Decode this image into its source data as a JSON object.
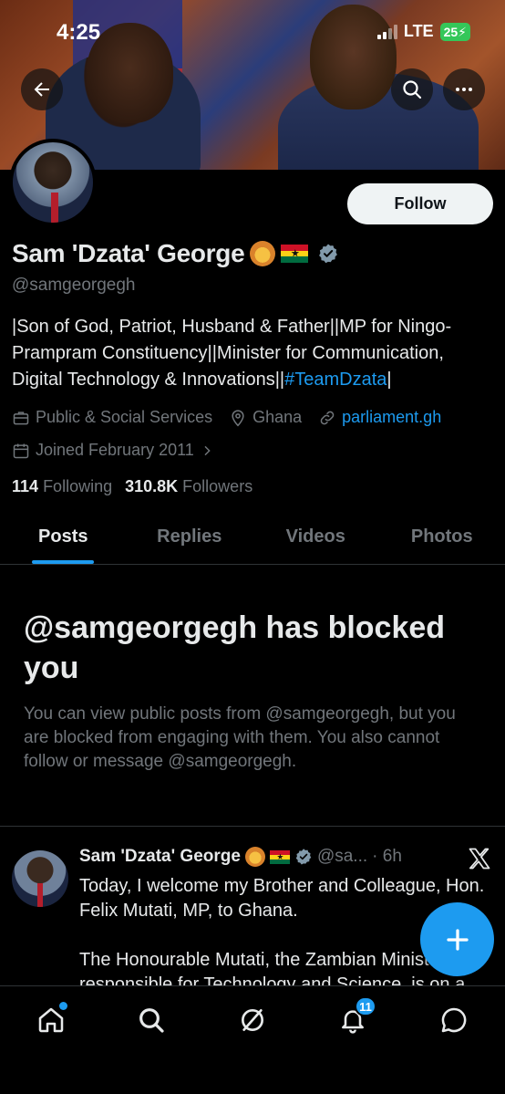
{
  "status_bar": {
    "time": "4:25",
    "network": "LTE",
    "battery": "25"
  },
  "profile": {
    "name": "Sam 'Dzata' George",
    "handle": "@samgeorgegh",
    "follow_label": "Follow",
    "bio_text": "|Son of God, Patriot, Husband & Father||MP for Ningo-Prampram Constituency||Minister for Communication, Digital Technology & Innovations||",
    "bio_hashtag": "#TeamDzata",
    "bio_end": "|",
    "category": "Public & Social Services",
    "location": "Ghana",
    "website": "parliament.gh",
    "joined": "Joined February 2011",
    "following_count": "114",
    "following_label": "Following",
    "followers_count": "310.8K",
    "followers_label": "Followers"
  },
  "tabs": [
    {
      "label": "Posts",
      "active": true
    },
    {
      "label": "Replies",
      "active": false
    },
    {
      "label": "Videos",
      "active": false
    },
    {
      "label": "Photos",
      "active": false
    }
  ],
  "blocked": {
    "title": "@samgeorgegh has blocked you",
    "description": "You can view public posts from @samgeorgegh, but you are blocked from engaging with them. You also cannot follow or message @samgeorgegh."
  },
  "tweet": {
    "name": "Sam 'Dzata' George",
    "handle": "@sa...",
    "time": "· 6h",
    "paragraph1": "Today, I welcome my Brother and Colleague, Hon. Felix Mutati, MP, to Ghana.",
    "paragraph2": "The Honourable Mutati, the Zambian Minister responsible for Technology and Science, is on a"
  },
  "bottom_nav": {
    "notifications_badge": "11"
  },
  "colors": {
    "accent": "#1d9bf0",
    "background": "#000000",
    "text_primary": "#e7e9ea",
    "text_secondary": "#71767b",
    "battery": "#34c759"
  }
}
